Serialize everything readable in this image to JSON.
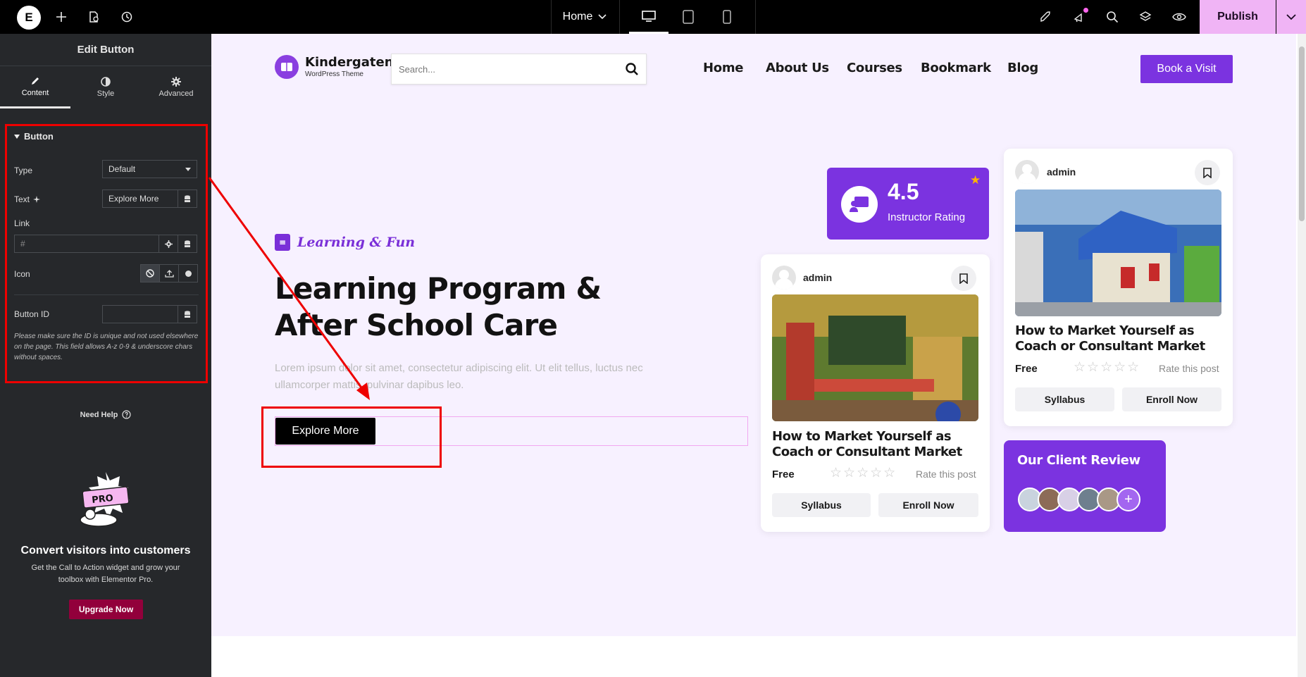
{
  "topbar": {
    "logo": "E",
    "page_selector": "Home",
    "publish_label": "Publish"
  },
  "panel": {
    "title": "Edit Button",
    "tabs": [
      {
        "label": "Content",
        "icon": "pencil-icon"
      },
      {
        "label": "Style",
        "icon": "half-circle-icon"
      },
      {
        "label": "Advanced",
        "icon": "gear-icon"
      }
    ],
    "section_title": "Button",
    "type_label": "Type",
    "type_value": "Default",
    "text_label": "Text",
    "text_value": "Explore More",
    "link_label": "Link",
    "link_placeholder": "#",
    "icon_label": "Icon",
    "button_id_label": "Button ID",
    "button_id_value": "",
    "help_text": "Please make sure the ID is unique and not used elsewhere on the page. This field allows A-z  0-9 & underscore chars without spaces.",
    "need_help": "Need Help",
    "promo_badge": "PRO",
    "promo_title": "Convert visitors into customers",
    "promo_desc": "Get the Call to Action widget and grow your toolbox with Elementor Pro.",
    "upgrade_label": "Upgrade Now"
  },
  "site": {
    "brand_name": "Kindergaten",
    "brand_sub": "WordPress Theme",
    "search_placeholder": "Search...",
    "nav": [
      "Home",
      "About Us",
      "Courses",
      "Bookmark",
      "Blog"
    ],
    "cta": "Book a Visit",
    "tagline": "Learning & Fun",
    "headline": "Learning Program & After School Care",
    "description": "Lorem ipsum dolor sit amet, consectetur adipiscing elit. Ut elit tellus, luctus nec ullamcorper mattis, pulvinar dapibus leo.",
    "explore_label": "Explore More",
    "rating": {
      "value": "4.5",
      "label": "Instructor Rating"
    },
    "cards": [
      {
        "author": "admin",
        "title": "How to Market Yourself as Coach or Consultant Market",
        "price": "Free",
        "rate_text": "Rate this post",
        "btn1": "Syllabus",
        "btn2": "Enroll Now"
      },
      {
        "author": "admin",
        "title": "How to Market Yourself as Coach or Consultant Market",
        "price": "Free",
        "rate_text": "Rate this post",
        "btn1": "Syllabus",
        "btn2": "Enroll Now"
      }
    ],
    "review_title": "Our Client Review",
    "review_plus": "+"
  },
  "colors": {
    "accent_purple": "#7b33e0",
    "publish_pink": "#f0b4f5",
    "annotation_red": "#ee0000",
    "upgrade_maroon": "#92003b"
  }
}
